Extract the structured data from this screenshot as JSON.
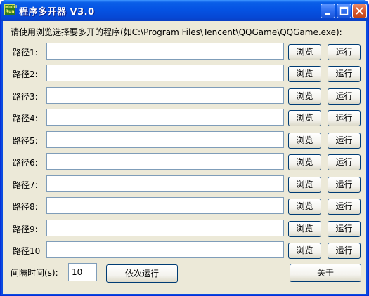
{
  "window": {
    "title": "程序多开器 V3.0",
    "icon_label": "Multi Run",
    "minimize_icon": "minimize-icon",
    "maximize_icon": "maximize-icon",
    "close_icon": "close-icon"
  },
  "prompt": "请使用浏览选择要多开的程序(如C:\\Program Files\\Tencent\\QQGame\\QQGame.exe):",
  "rows": [
    {
      "label": "路径1:",
      "value": "",
      "browse": "浏览",
      "run": "运行"
    },
    {
      "label": "路径2:",
      "value": "",
      "browse": "浏览",
      "run": "运行"
    },
    {
      "label": "路径3:",
      "value": "",
      "browse": "浏览",
      "run": "运行"
    },
    {
      "label": "路径4:",
      "value": "",
      "browse": "浏览",
      "run": "运行"
    },
    {
      "label": "路径5:",
      "value": "",
      "browse": "浏览",
      "run": "运行"
    },
    {
      "label": "路径6:",
      "value": "",
      "browse": "浏览",
      "run": "运行"
    },
    {
      "label": "路径7:",
      "value": "",
      "browse": "浏览",
      "run": "运行"
    },
    {
      "label": "路径8:",
      "value": "",
      "browse": "浏览",
      "run": "运行"
    },
    {
      "label": "路径9:",
      "value": "",
      "browse": "浏览",
      "run": "运行"
    },
    {
      "label": "路径10",
      "value": "",
      "browse": "浏览",
      "run": "运行"
    }
  ],
  "footer": {
    "interval_label": "间隔时间(s):",
    "interval_value": "10",
    "sequential_button": "依次运行",
    "about_button": "关于"
  },
  "colors": {
    "titlebar": "#0553e3",
    "dialog_bg": "#ece9d8",
    "input_border": "#7f9db9",
    "button_border": "#003c74"
  }
}
